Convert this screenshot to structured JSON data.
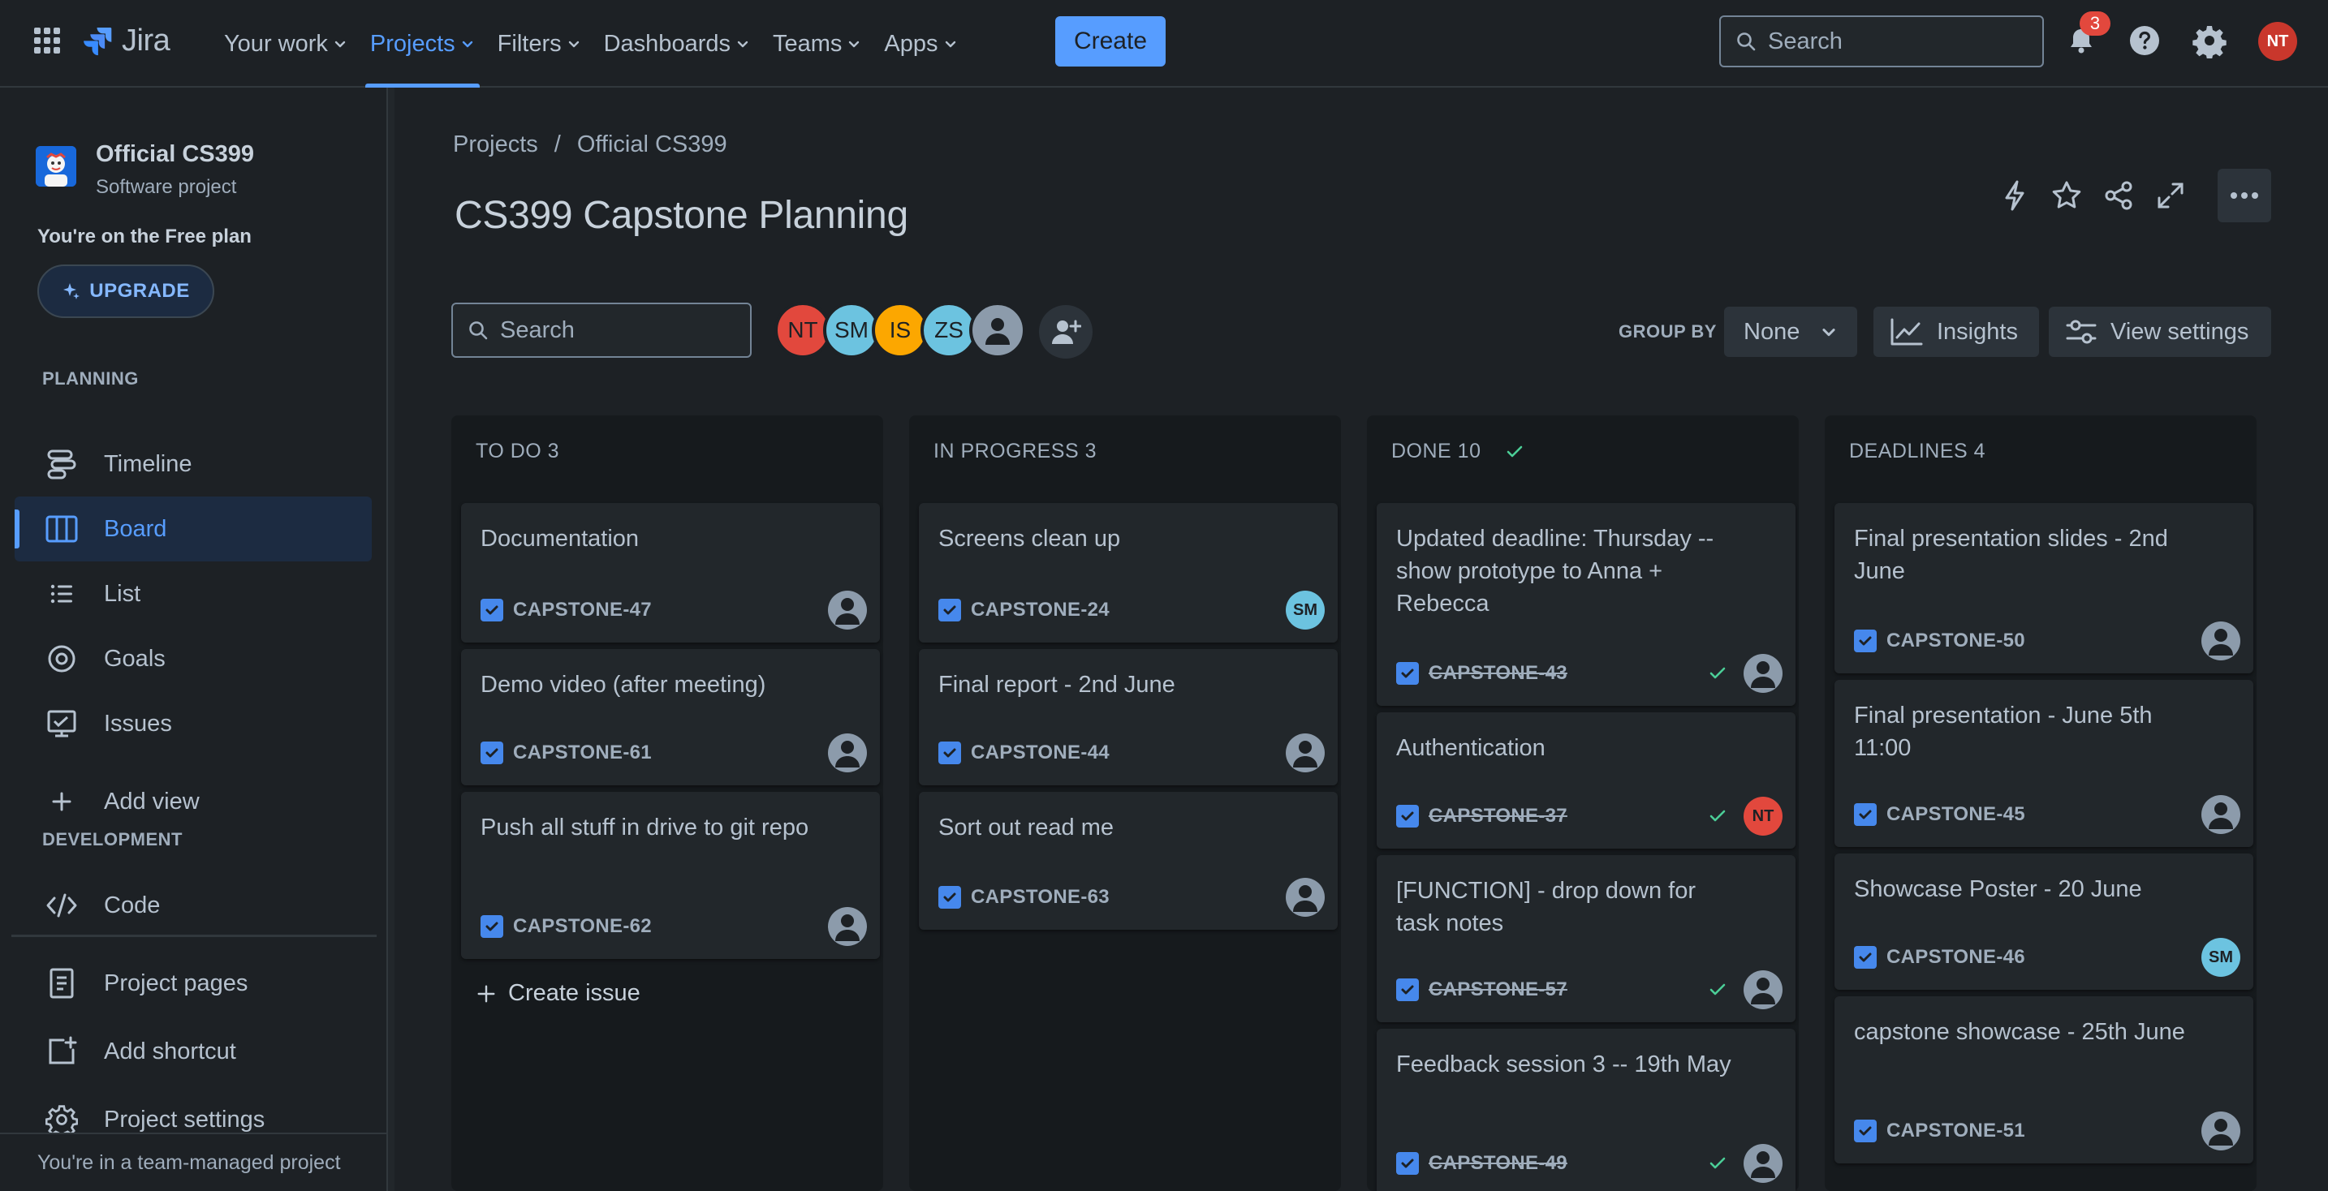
{
  "app": {
    "logo_text": "Jira",
    "nav": [
      {
        "label": "Your work"
      },
      {
        "label": "Projects"
      },
      {
        "label": "Filters"
      },
      {
        "label": "Dashboards"
      },
      {
        "label": "Teams"
      },
      {
        "label": "Apps"
      }
    ],
    "active_nav": "Projects",
    "create_label": "Create",
    "search_placeholder": "Search",
    "notification_count": "3",
    "user_initials": "NT"
  },
  "sidebar": {
    "project_name": "Official CS399",
    "project_type": "Software project",
    "plan_text": "You're on the Free plan",
    "upgrade_label": "UPGRADE",
    "planning_label": "PLANNING",
    "planning_items": [
      {
        "label": "Timeline",
        "icon": "timeline-icon"
      },
      {
        "label": "Board",
        "icon": "board-icon",
        "active": true
      },
      {
        "label": "List",
        "icon": "list-icon"
      },
      {
        "label": "Goals",
        "icon": "goals-icon"
      },
      {
        "label": "Issues",
        "icon": "issues-icon"
      }
    ],
    "add_view_label": "Add view",
    "development_label": "DEVELOPMENT",
    "code_label": "Code",
    "project_pages_label": "Project pages",
    "add_shortcut_label": "Add shortcut",
    "project_settings_label": "Project settings",
    "footer_text": "You're in a team-managed project"
  },
  "main": {
    "breadcrumb": [
      "Projects",
      "Official CS399"
    ],
    "breadcrumb_sep": "/",
    "title": "CS399 Capstone Planning",
    "search_placeholder": "Search",
    "avatars": [
      {
        "initials": "NT",
        "color": "#e2483d"
      },
      {
        "initials": "SM",
        "color": "#6cc3e0"
      },
      {
        "initials": "IS",
        "color": "#fca700"
      },
      {
        "initials": "ZS",
        "color": "#6cc3e0"
      },
      {
        "initials": "",
        "color": "#8c9bab"
      }
    ],
    "group_by_label": "GROUP BY",
    "group_by_value": "None",
    "insights_label": "Insights",
    "view_settings_label": "View settings",
    "create_issue_label": "Create issue"
  },
  "colors": {
    "accent": "#579dff",
    "card_bg": "#22272b",
    "column_bg": "#161a1d",
    "done_green": "#4bce97"
  },
  "columns": [
    {
      "title": "TO DO 3",
      "done": false,
      "cards": [
        {
          "title": "Documentation",
          "key": "CAPSTONE-47",
          "assignee": ""
        },
        {
          "title": "Demo video (after meeting)",
          "key": "CAPSTONE-61",
          "assignee": ""
        },
        {
          "title": "Push all stuff in drive to git repo",
          "key": "CAPSTONE-62",
          "assignee": ""
        }
      ]
    },
    {
      "title": "IN PROGRESS 3",
      "done": false,
      "cards": [
        {
          "title": "Screens clean up",
          "key": "CAPSTONE-24",
          "assignee": "SM"
        },
        {
          "title": "Final report - 2nd June",
          "key": "CAPSTONE-44",
          "assignee": ""
        },
        {
          "title": "Sort out read me",
          "key": "CAPSTONE-63",
          "assignee": ""
        }
      ]
    },
    {
      "title": "DONE 10",
      "done": true,
      "cards": [
        {
          "title": "Updated deadline: Thursday -- show prototype to Anna + Rebecca",
          "key": "CAPSTONE-43",
          "assignee": ""
        },
        {
          "title": "Authentication",
          "key": "CAPSTONE-37",
          "assignee": "NT"
        },
        {
          "title": "[FUNCTION] - drop down for task notes",
          "key": "CAPSTONE-57",
          "assignee": ""
        },
        {
          "title": "Feedback session 3 -- 19th May",
          "key": "CAPSTONE-49",
          "assignee": ""
        }
      ]
    },
    {
      "title": "DEADLINES 4",
      "done": false,
      "cards": [
        {
          "title": "Final presentation slides - 2nd June",
          "key": "CAPSTONE-50",
          "assignee": ""
        },
        {
          "title": "Final presentation - June 5th 11:00",
          "key": "CAPSTONE-45",
          "assignee": ""
        },
        {
          "title": "Showcase Poster - 20 June",
          "key": "CAPSTONE-46",
          "assignee": "SM"
        },
        {
          "title": "capstone showcase - 25th June",
          "key": "CAPSTONE-51",
          "assignee": ""
        }
      ]
    }
  ]
}
